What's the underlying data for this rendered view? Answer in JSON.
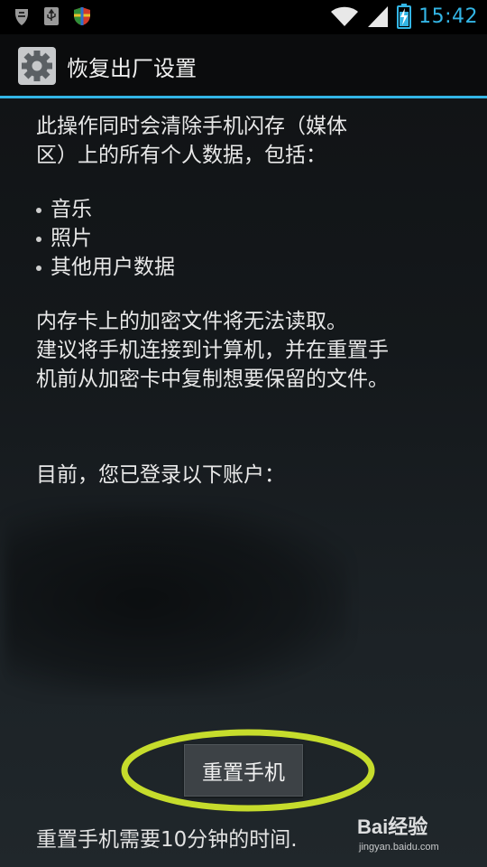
{
  "status_bar": {
    "left_icons": [
      "notification-icon",
      "usb-icon",
      "shield-icon"
    ],
    "right_icons": [
      "wifi-icon",
      "signal-icon",
      "battery-charging-icon"
    ],
    "time": "15:42",
    "accent_color": "#33b5e5"
  },
  "title_bar": {
    "icon": "gear-icon",
    "title": "恢复出厂设置"
  },
  "content": {
    "intro_line1": "此操作同时会清除手机闪存（媒体",
    "intro_line2": "区）上的所有个人数据，包括：",
    "bullets": [
      {
        "label": "音乐"
      },
      {
        "label": "照片"
      },
      {
        "label": "其他用户数据"
      }
    ],
    "warning_line1": "内存卡上的加密文件将无法读取。",
    "warning_line2": "建议将手机连接到计算机，并在重置手",
    "warning_line3": "机前从加密卡中复制想要保留的文件。",
    "accounts_label": "目前，您已登录以下账户："
  },
  "reset_button": {
    "label": "重置手机",
    "highlight_color": "#c6dc2c"
  },
  "footer_note": "重置手机需要10分钟的时间.",
  "watermark": {
    "main": "Bai经验",
    "sub": "jingyan.baidu.com"
  }
}
